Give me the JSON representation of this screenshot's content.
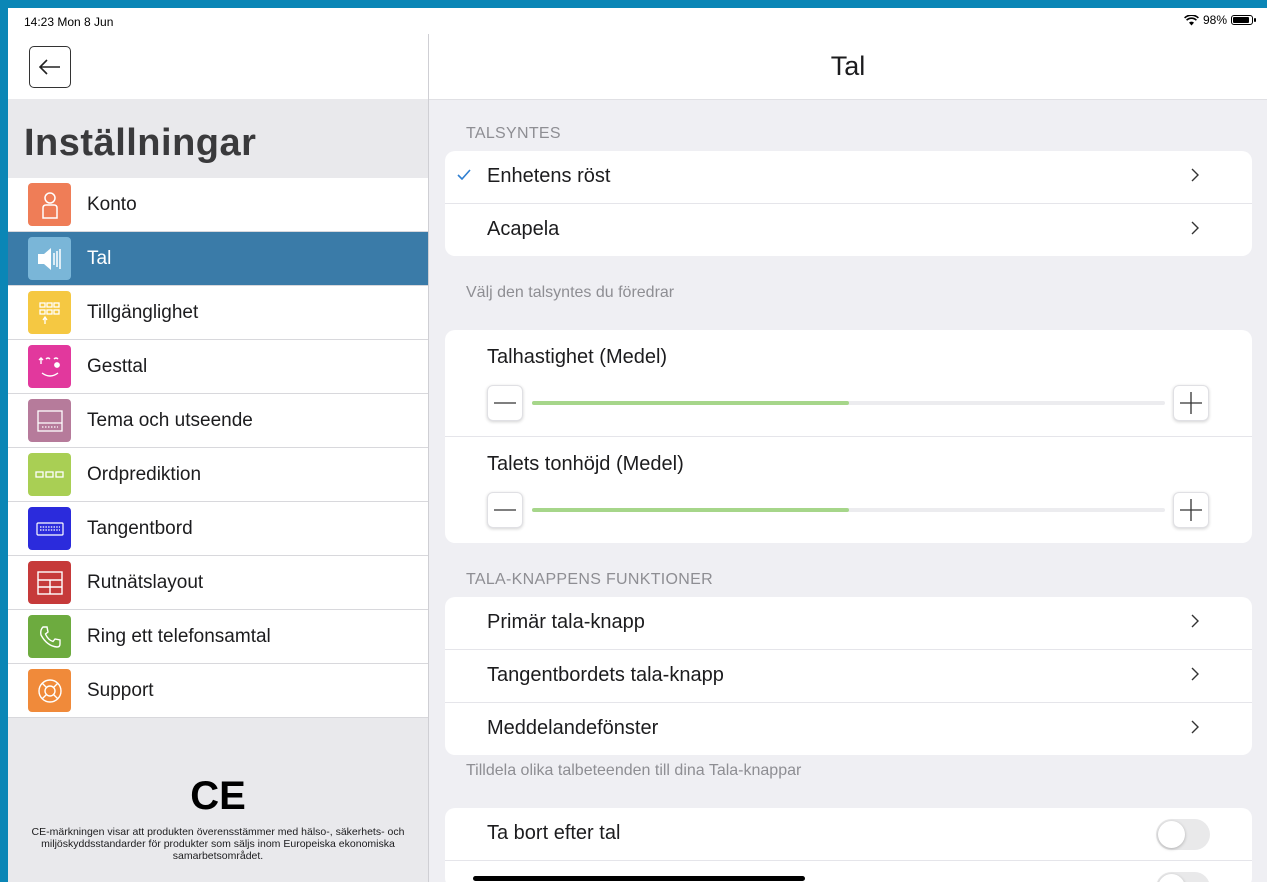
{
  "status_bar": {
    "time": "14:23  Mon 8 Jun",
    "battery": "98%"
  },
  "sidebar": {
    "title": "Inställningar",
    "items": [
      {
        "label": "Konto",
        "icon": "person-icon",
        "color": "#ef7d57"
      },
      {
        "label": "Tal",
        "icon": "speaker-icon",
        "color": "#7ab6d8",
        "active": true
      },
      {
        "label": "Tillgänglighet",
        "icon": "grid-touch-icon",
        "color": "#f5c842"
      },
      {
        "label": "Gesttal",
        "icon": "face-gesture-icon",
        "color": "#e2389d"
      },
      {
        "label": "Tema och utseende",
        "icon": "theme-icon",
        "color": "#b67b9b"
      },
      {
        "label": "Ordprediktion",
        "icon": "prediction-icon",
        "color": "#a9cf54"
      },
      {
        "label": "Tangentbord",
        "icon": "keyboard-icon",
        "color": "#2b2bdc"
      },
      {
        "label": "Rutnätslayout",
        "icon": "grid-layout-icon",
        "color": "#c63a3a"
      },
      {
        "label": "Ring ett telefonsamtal",
        "icon": "phone-icon",
        "color": "#6dab3f"
      },
      {
        "label": "Support",
        "icon": "lifebuoy-icon",
        "color": "#f08a3a"
      }
    ],
    "ce_mark": "CE",
    "ce_text": "CE-märkningen visar att produkten överensstämmer med hälso-, säkerhets- och miljöskyddsstandarder för produkter som säljs inom Europeiska ekonomiska samarbetsområdet."
  },
  "main": {
    "title": "Tal",
    "talsyntes": {
      "header": "TALSYNTES",
      "options": [
        {
          "label": "Enhetens röst",
          "selected": true
        },
        {
          "label": "Acapela",
          "selected": false
        }
      ],
      "footnote": "Välj den talsyntes du föredrar"
    },
    "sliders": [
      {
        "label": "Talhastighet (Medel)",
        "value": 0.5
      },
      {
        "label": "Talets tonhöjd (Medel)",
        "value": 0.5
      }
    ],
    "tala_knappens": {
      "header": "TALA-KNAPPENS FUNKTIONER",
      "items": [
        "Primär tala-knapp",
        "Tangentbordets tala-knapp",
        "Meddelandefönster"
      ],
      "footnote": "Tilldela olika talbeteenden till dina Tala-knappar"
    },
    "toggles": [
      {
        "label": "Ta bort efter tal",
        "on": false
      }
    ]
  },
  "colors": {
    "accent": "#3a7ba8",
    "slider_fill": "#a6d68a",
    "background": "#0a86b6"
  }
}
